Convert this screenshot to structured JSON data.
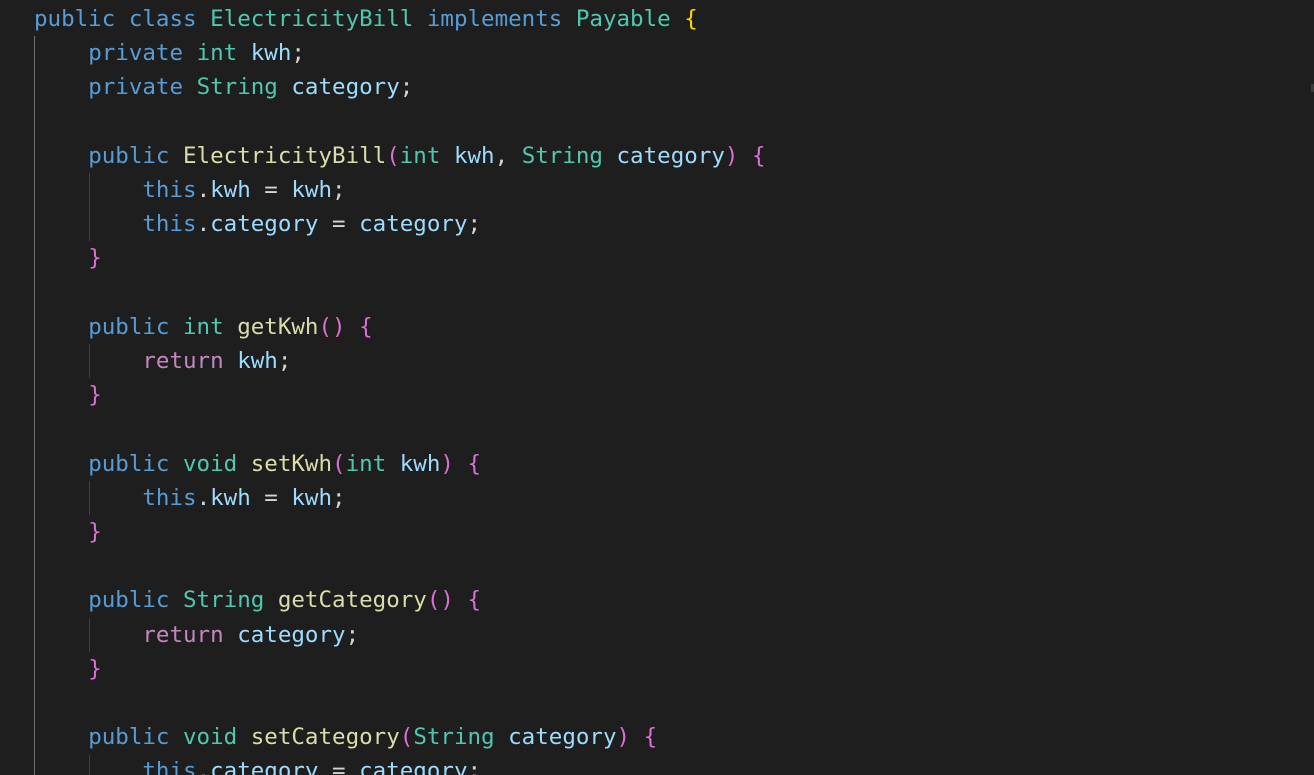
{
  "editor": {
    "language": "java",
    "colors": {
      "background": "#1e1e1e",
      "keyword": "#569cd6",
      "control": "#c586c0",
      "type": "#4ec9b0",
      "function": "#dcdcaa",
      "variable": "#9cdcfe",
      "punctuation": "#d4d4d4",
      "bracket_level_1": "#ffd700",
      "bracket_level_2": "#da70d6",
      "bracket_level_3": "#179fff"
    },
    "lines": [
      [
        [
          "kw",
          "public"
        ],
        [
          "ws",
          " "
        ],
        [
          "kw",
          "class"
        ],
        [
          "ws",
          " "
        ],
        [
          "type",
          "ElectricityBill"
        ],
        [
          "ws",
          " "
        ],
        [
          "kw",
          "implements"
        ],
        [
          "ws",
          " "
        ],
        [
          "type",
          "Payable"
        ],
        [
          "ws",
          " "
        ],
        [
          "b1",
          "{"
        ]
      ],
      [
        [
          "ws",
          "    "
        ],
        [
          "kw",
          "private"
        ],
        [
          "ws",
          " "
        ],
        [
          "type",
          "int"
        ],
        [
          "ws",
          " "
        ],
        [
          "var",
          "kwh"
        ],
        [
          "punc",
          ";"
        ]
      ],
      [
        [
          "ws",
          "    "
        ],
        [
          "kw",
          "private"
        ],
        [
          "ws",
          " "
        ],
        [
          "type",
          "String"
        ],
        [
          "ws",
          " "
        ],
        [
          "var",
          "category"
        ],
        [
          "punc",
          ";"
        ]
      ],
      [],
      [
        [
          "ws",
          "    "
        ],
        [
          "kw",
          "public"
        ],
        [
          "ws",
          " "
        ],
        [
          "fn",
          "ElectricityBill"
        ],
        [
          "b2",
          "("
        ],
        [
          "type",
          "int"
        ],
        [
          "ws",
          " "
        ],
        [
          "var",
          "kwh"
        ],
        [
          "punc",
          ","
        ],
        [
          "ws",
          " "
        ],
        [
          "type",
          "String"
        ],
        [
          "ws",
          " "
        ],
        [
          "var",
          "category"
        ],
        [
          "b2",
          ")"
        ],
        [
          "ws",
          " "
        ],
        [
          "b2",
          "{"
        ]
      ],
      [
        [
          "ws",
          "        "
        ],
        [
          "kw",
          "this"
        ],
        [
          "punc",
          "."
        ],
        [
          "var",
          "kwh"
        ],
        [
          "ws",
          " "
        ],
        [
          "punc",
          "="
        ],
        [
          "ws",
          " "
        ],
        [
          "var",
          "kwh"
        ],
        [
          "punc",
          ";"
        ]
      ],
      [
        [
          "ws",
          "        "
        ],
        [
          "kw",
          "this"
        ],
        [
          "punc",
          "."
        ],
        [
          "var",
          "category"
        ],
        [
          "ws",
          " "
        ],
        [
          "punc",
          "="
        ],
        [
          "ws",
          " "
        ],
        [
          "var",
          "category"
        ],
        [
          "punc",
          ";"
        ]
      ],
      [
        [
          "ws",
          "    "
        ],
        [
          "b2",
          "}"
        ]
      ],
      [],
      [
        [
          "ws",
          "    "
        ],
        [
          "kw",
          "public"
        ],
        [
          "ws",
          " "
        ],
        [
          "type",
          "int"
        ],
        [
          "ws",
          " "
        ],
        [
          "fn",
          "getKwh"
        ],
        [
          "b2",
          "()"
        ],
        [
          "ws",
          " "
        ],
        [
          "b2",
          "{"
        ]
      ],
      [
        [
          "ws",
          "        "
        ],
        [
          "ctl",
          "return"
        ],
        [
          "ws",
          " "
        ],
        [
          "var",
          "kwh"
        ],
        [
          "punc",
          ";"
        ]
      ],
      [
        [
          "ws",
          "    "
        ],
        [
          "b2",
          "}"
        ]
      ],
      [],
      [
        [
          "ws",
          "    "
        ],
        [
          "kw",
          "public"
        ],
        [
          "ws",
          " "
        ],
        [
          "type",
          "void"
        ],
        [
          "ws",
          " "
        ],
        [
          "fn",
          "setKwh"
        ],
        [
          "b2",
          "("
        ],
        [
          "type",
          "int"
        ],
        [
          "ws",
          " "
        ],
        [
          "var",
          "kwh"
        ],
        [
          "b2",
          ")"
        ],
        [
          "ws",
          " "
        ],
        [
          "b2",
          "{"
        ]
      ],
      [
        [
          "ws",
          "        "
        ],
        [
          "kw",
          "this"
        ],
        [
          "punc",
          "."
        ],
        [
          "var",
          "kwh"
        ],
        [
          "ws",
          " "
        ],
        [
          "punc",
          "="
        ],
        [
          "ws",
          " "
        ],
        [
          "var",
          "kwh"
        ],
        [
          "punc",
          ";"
        ]
      ],
      [
        [
          "ws",
          "    "
        ],
        [
          "b2",
          "}"
        ]
      ],
      [],
      [
        [
          "ws",
          "    "
        ],
        [
          "kw",
          "public"
        ],
        [
          "ws",
          " "
        ],
        [
          "type",
          "String"
        ],
        [
          "ws",
          " "
        ],
        [
          "fn",
          "getCategory"
        ],
        [
          "b2",
          "()"
        ],
        [
          "ws",
          " "
        ],
        [
          "b2",
          "{"
        ]
      ],
      [
        [
          "ws",
          "        "
        ],
        [
          "ctl",
          "return"
        ],
        [
          "ws",
          " "
        ],
        [
          "var",
          "category"
        ],
        [
          "punc",
          ";"
        ]
      ],
      [
        [
          "ws",
          "    "
        ],
        [
          "b2",
          "}"
        ]
      ],
      [],
      [
        [
          "ws",
          "    "
        ],
        [
          "kw",
          "public"
        ],
        [
          "ws",
          " "
        ],
        [
          "type",
          "void"
        ],
        [
          "ws",
          " "
        ],
        [
          "fn",
          "setCategory"
        ],
        [
          "b2",
          "("
        ],
        [
          "type",
          "String"
        ],
        [
          "ws",
          " "
        ],
        [
          "var",
          "category"
        ],
        [
          "b2",
          ")"
        ],
        [
          "ws",
          " "
        ],
        [
          "b2",
          "{"
        ]
      ],
      [
        [
          "ws",
          "        "
        ],
        [
          "kw",
          "this"
        ],
        [
          "punc",
          "."
        ],
        [
          "var",
          "category"
        ],
        [
          "ws",
          " "
        ],
        [
          "punc",
          "="
        ],
        [
          "ws",
          " "
        ],
        [
          "var",
          "category"
        ],
        [
          "punc",
          ";"
        ]
      ]
    ]
  }
}
